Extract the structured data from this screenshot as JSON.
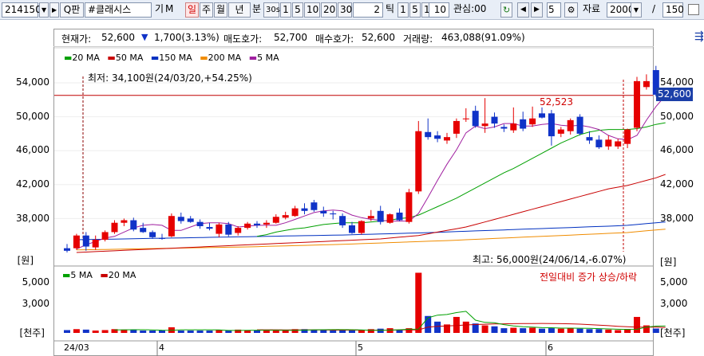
{
  "toolbar": {
    "code": "214150",
    "search_icon_label": "Q",
    "search_label": "판",
    "name": "#클래시스",
    "gi": "기",
    "m": "M",
    "periods": [
      "일",
      "주",
      "월",
      "년"
    ],
    "bun": "분",
    "sec": "30s",
    "min_opts": [
      "1",
      "5",
      "10",
      "20",
      "30"
    ],
    "tick_value": "2",
    "tick_label": "틱",
    "tick_opts": [
      "1",
      "5",
      "10"
    ],
    "tick_sel": "10",
    "interest": "관심:00",
    "nav_value": "5",
    "data_label": "자료",
    "data_count": "2000",
    "slash": "/",
    "view_count": "150"
  },
  "info": {
    "price_label": "현재가:",
    "price": "52,600",
    "change": "1,700(3.13%)",
    "ask_label": "매도호가:",
    "ask": "52,700",
    "bid_label": "매수호가:",
    "bid": "52,600",
    "vol_label": "거래량:",
    "vol": "463,088(91.09%)"
  },
  "legend": {
    "price": [
      "20 MA",
      "50 MA",
      "150 MA",
      "200 MA",
      "5 MA"
    ],
    "volume": [
      "5 MA",
      "20 MA"
    ]
  },
  "colors": {
    "up": "#e60000",
    "down": "#1033c8",
    "ma5": "#a020a0",
    "ma20": "#00a000",
    "ma50": "#c80000",
    "ma150": "#0030c0",
    "ma200": "#f08c00"
  },
  "labels": {
    "min": "최저: 34,100원(24/03/20,+54.25%)",
    "max": "최고: 56,000원(24/06/14,-6.07%)",
    "ref_value": "52,523",
    "current": "52,600",
    "unit_price": "[원]",
    "unit_volume": "[천주]",
    "vol_note": "전일대비 증가 상승/하락"
  },
  "axes": {
    "price_ticks": [
      "54,000",
      "50,000",
      "46,000",
      "42,000",
      "38,000"
    ],
    "volume_ticks": [
      "5,000",
      "3,000"
    ],
    "x_labels": [
      "24/03",
      "4",
      "5",
      "6"
    ]
  },
  "chart_data": {
    "type": "candlestick",
    "price_ticks": [
      54000,
      50000,
      46000,
      42000,
      38000
    ],
    "volume_ticks": [
      5000,
      3000
    ],
    "reference_line": 52523,
    "current_price": 52600,
    "candles": [
      {
        "o": 34500,
        "h": 35000,
        "l": 34000,
        "c": 34200,
        "v": 300
      },
      {
        "o": 34500,
        "h": 36200,
        "l": 34300,
        "c": 36000,
        "v": 400
      },
      {
        "o": 36000,
        "h": 36400,
        "l": 34200,
        "c": 34700,
        "v": 350
      },
      {
        "o": 34600,
        "h": 36000,
        "l": 34300,
        "c": 35500,
        "v": 250
      },
      {
        "o": 35500,
        "h": 36600,
        "l": 35300,
        "c": 36400,
        "v": 300
      },
      {
        "o": 36400,
        "h": 37800,
        "l": 36200,
        "c": 37500,
        "v": 400
      },
      {
        "o": 37500,
        "h": 38000,
        "l": 37100,
        "c": 37800,
        "v": 350
      },
      {
        "o": 37800,
        "h": 38100,
        "l": 36500,
        "c": 36700,
        "v": 300
      },
      {
        "o": 36900,
        "h": 37500,
        "l": 36300,
        "c": 36400,
        "v": 250
      },
      {
        "o": 36400,
        "h": 36600,
        "l": 35600,
        "c": 35800,
        "v": 250
      },
      {
        "o": 35700,
        "h": 36200,
        "l": 35500,
        "c": 35600,
        "v": 250
      },
      {
        "o": 35900,
        "h": 38600,
        "l": 35800,
        "c": 38300,
        "v": 600
      },
      {
        "o": 38200,
        "h": 38700,
        "l": 37400,
        "c": 37700,
        "v": 250
      },
      {
        "o": 38000,
        "h": 38300,
        "l": 37500,
        "c": 37600,
        "v": 250
      },
      {
        "o": 37600,
        "h": 37900,
        "l": 36800,
        "c": 37100,
        "v": 250
      },
      {
        "o": 37000,
        "h": 37500,
        "l": 36600,
        "c": 36800,
        "v": 250
      },
      {
        "o": 36200,
        "h": 37500,
        "l": 35800,
        "c": 37300,
        "v": 300
      },
      {
        "o": 37300,
        "h": 37600,
        "l": 35900,
        "c": 36100,
        "v": 250
      },
      {
        "o": 36300,
        "h": 37100,
        "l": 36000,
        "c": 36900,
        "v": 350
      },
      {
        "o": 36900,
        "h": 37600,
        "l": 36700,
        "c": 37400,
        "v": 300
      },
      {
        "o": 37400,
        "h": 37700,
        "l": 36900,
        "c": 37200,
        "v": 250
      },
      {
        "o": 37300,
        "h": 37800,
        "l": 36900,
        "c": 37500,
        "v": 250
      },
      {
        "o": 37500,
        "h": 38500,
        "l": 37400,
        "c": 38200,
        "v": 250
      },
      {
        "o": 38100,
        "h": 38800,
        "l": 37900,
        "c": 38400,
        "v": 300
      },
      {
        "o": 38300,
        "h": 39500,
        "l": 38200,
        "c": 39200,
        "v": 400
      },
      {
        "o": 39200,
        "h": 39800,
        "l": 38500,
        "c": 38900,
        "v": 400
      },
      {
        "o": 39900,
        "h": 40200,
        "l": 38800,
        "c": 39000,
        "v": 350
      },
      {
        "o": 38900,
        "h": 39400,
        "l": 38200,
        "c": 38600,
        "v": 300
      },
      {
        "o": 38600,
        "h": 38900,
        "l": 37900,
        "c": 38500,
        "v": 250
      },
      {
        "o": 38300,
        "h": 38600,
        "l": 36900,
        "c": 37200,
        "v": 300
      },
      {
        "o": 37200,
        "h": 37600,
        "l": 36200,
        "c": 36300,
        "v": 250
      },
      {
        "o": 36300,
        "h": 37800,
        "l": 36100,
        "c": 37700,
        "v": 300
      },
      {
        "o": 38000,
        "h": 39000,
        "l": 37700,
        "c": 38300,
        "v": 400
      },
      {
        "o": 38900,
        "h": 39500,
        "l": 37300,
        "c": 37600,
        "v": 450
      },
      {
        "o": 37500,
        "h": 38600,
        "l": 37400,
        "c": 38500,
        "v": 500
      },
      {
        "o": 38700,
        "h": 39200,
        "l": 37700,
        "c": 37800,
        "v": 300
      },
      {
        "o": 37600,
        "h": 41500,
        "l": 37400,
        "c": 41100,
        "v": 500
      },
      {
        "o": 41200,
        "h": 49500,
        "l": 40900,
        "c": 48300,
        "v": 6400
      },
      {
        "o": 48200,
        "h": 49800,
        "l": 47300,
        "c": 47600,
        "v": 1800
      },
      {
        "o": 47800,
        "h": 48300,
        "l": 47000,
        "c": 47400,
        "v": 1200
      },
      {
        "o": 47200,
        "h": 48100,
        "l": 46800,
        "c": 47600,
        "v": 900
      },
      {
        "o": 48000,
        "h": 49800,
        "l": 47500,
        "c": 49500,
        "v": 1700
      },
      {
        "o": 49700,
        "h": 51000,
        "l": 49400,
        "c": 49800,
        "v": 1200
      },
      {
        "o": 50700,
        "h": 51300,
        "l": 48700,
        "c": 48900,
        "v": 1000
      },
      {
        "o": 48900,
        "h": 52200,
        "l": 48100,
        "c": 49200,
        "v": 800
      },
      {
        "o": 50000,
        "h": 50500,
        "l": 48700,
        "c": 49200,
        "v": 700
      },
      {
        "o": 48800,
        "h": 49100,
        "l": 48200,
        "c": 48600,
        "v": 500
      },
      {
        "o": 48400,
        "h": 51100,
        "l": 48100,
        "c": 49200,
        "v": 550
      },
      {
        "o": 49700,
        "h": 50600,
        "l": 48300,
        "c": 48600,
        "v": 500
      },
      {
        "o": 49100,
        "h": 51200,
        "l": 48800,
        "c": 49800,
        "v": 550
      },
      {
        "o": 50400,
        "h": 51100,
        "l": 49800,
        "c": 49900,
        "v": 450
      },
      {
        "o": 50400,
        "h": 50800,
        "l": 46600,
        "c": 47700,
        "v": 500
      },
      {
        "o": 48000,
        "h": 48800,
        "l": 47600,
        "c": 48500,
        "v": 450
      },
      {
        "o": 48300,
        "h": 49800,
        "l": 47900,
        "c": 49600,
        "v": 500
      },
      {
        "o": 50000,
        "h": 50300,
        "l": 47800,
        "c": 48000,
        "v": 450
      },
      {
        "o": 47600,
        "h": 48300,
        "l": 46800,
        "c": 47200,
        "v": 400
      },
      {
        "o": 47300,
        "h": 47800,
        "l": 46200,
        "c": 46400,
        "v": 400
      },
      {
        "o": 46500,
        "h": 47800,
        "l": 46100,
        "c": 47300,
        "v": 350
      },
      {
        "o": 46500,
        "h": 47400,
        "l": 46200,
        "c": 47100,
        "v": 300
      },
      {
        "o": 46800,
        "h": 48600,
        "l": 46300,
        "c": 48500,
        "v": 400
      },
      {
        "o": 48700,
        "h": 54700,
        "l": 48300,
        "c": 54200,
        "v": 1700
      },
      {
        "o": 53500,
        "h": 55000,
        "l": 53200,
        "c": 54200,
        "v": 800
      },
      {
        "o": 55500,
        "h": 56000,
        "l": 52400,
        "c": 52600,
        "v": 463
      }
    ],
    "ma5": [
      34400,
      34900,
      35300,
      35700,
      35900,
      36400,
      36900,
      37200,
      37300,
      37200,
      36600,
      36600,
      37000,
      37400,
      37500,
      37500,
      37400,
      37000,
      37100,
      37200,
      37200,
      37200,
      37500,
      37900,
      38300,
      38700,
      38900,
      39000,
      38900,
      38400,
      38100,
      37900,
      37800,
      37700,
      37700,
      37700,
      38600,
      40500,
      42500,
      44400,
      46100,
      48100,
      48900,
      48600,
      48800,
      49200,
      49200,
      48900,
      48900,
      49100,
      49200,
      49000,
      48900,
      49000,
      48800,
      48500,
      47800,
      47400,
      47300,
      47800,
      49600,
      51200,
      52500
    ],
    "ma20": [
      null,
      null,
      null,
      null,
      null,
      null,
      null,
      null,
      null,
      null,
      null,
      null,
      null,
      null,
      null,
      null,
      null,
      null,
      null,
      35900,
      36100,
      36400,
      36600,
      36800,
      36900,
      37100,
      37300,
      37400,
      37500,
      37500,
      37500,
      37600,
      37700,
      37800,
      38000,
      38100,
      38400,
      38900,
      39400,
      39900,
      40400,
      41000,
      41600,
      42200,
      42800,
      43400,
      43900,
      44500,
      45100,
      45700,
      46300,
      46900,
      47400,
      47900,
      48200,
      48400,
      48500,
      48500,
      48500,
      48600,
      48800,
      49100,
      49300
    ],
    "ma50": [
      34000,
      34050,
      34100,
      34150,
      34200,
      34250,
      34300,
      34350,
      34400,
      34450,
      34500,
      34550,
      34600,
      34650,
      34700,
      34750,
      34800,
      34850,
      34900,
      34950,
      35000,
      35050,
      35100,
      35150,
      35200,
      35250,
      35300,
      35350,
      35400,
      35450,
      35500,
      35550,
      35600,
      35700,
      35800,
      35900,
      36000,
      36200,
      36400,
      36600,
      36800,
      37000,
      37300,
      37600,
      37900,
      38200,
      38500,
      38800,
      39100,
      39400,
      39700,
      40000,
      40300,
      40600,
      40900,
      41200,
      41500,
      41700,
      41900,
      42200,
      42500,
      42800,
      43200
    ],
    "ma150": [
      35500,
      35520,
      35540,
      35560,
      35580,
      35600,
      35620,
      35640,
      35660,
      35680,
      35700,
      35720,
      35740,
      35760,
      35780,
      35800,
      35820,
      35840,
      35860,
      35880,
      35900,
      35920,
      35940,
      35960,
      35980,
      36000,
      36020,
      36040,
      36060,
      36090,
      36120,
      36150,
      36180,
      36210,
      36240,
      36270,
      36300,
      36340,
      36380,
      36420,
      36460,
      36500,
      36540,
      36580,
      36620,
      36660,
      36700,
      36740,
      36780,
      36820,
      36860,
      36900,
      36940,
      36980,
      37020,
      37060,
      37100,
      37150,
      37200,
      37300,
      37400,
      37500,
      37600
    ],
    "ma200": [
      34300,
      34320,
      34340,
      34360,
      34380,
      34400,
      34420,
      34440,
      34460,
      34480,
      34500,
      34520,
      34540,
      34560,
      34580,
      34600,
      34620,
      34640,
      34660,
      34690,
      34720,
      34750,
      34780,
      34810,
      34840,
      34870,
      34900,
      34930,
      34960,
      35000,
      35040,
      35080,
      35120,
      35160,
      35200,
      35240,
      35280,
      35320,
      35360,
      35400,
      35450,
      35500,
      35550,
      35600,
      35650,
      35700,
      35750,
      35800,
      35850,
      35900,
      35950,
      36000,
      36050,
      36100,
      36150,
      36200,
      36250,
      36300,
      36350,
      36450,
      36550,
      36650,
      36750
    ],
    "vma5": [
      null,
      null,
      null,
      null,
      320,
      330,
      340,
      340,
      320,
      290,
      280,
      330,
      330,
      330,
      330,
      320,
      260,
      260,
      280,
      290,
      290,
      290,
      270,
      270,
      300,
      330,
      340,
      350,
      350,
      340,
      320,
      280,
      280,
      300,
      340,
      390,
      400,
      1610,
      1890,
      1960,
      2160,
      2300,
      1360,
      1120,
      1080,
      880,
      740,
      650,
      610,
      560,
      550,
      510,
      510,
      500,
      490,
      460,
      420,
      390,
      370,
      380,
      620,
      720,
      730
    ],
    "vma20": [
      null,
      null,
      null,
      null,
      null,
      null,
      null,
      null,
      null,
      null,
      null,
      null,
      null,
      null,
      null,
      null,
      null,
      null,
      null,
      330,
      330,
      330,
      320,
      320,
      310,
      310,
      310,
      300,
      300,
      300,
      300,
      300,
      300,
      300,
      310,
      310,
      320,
      620,
      700,
      740,
      780,
      850,
      890,
      920,
      950,
      970,
      980,
      990,
      1000,
      1010,
      1000,
      980,
      970,
      930,
      880,
      820,
      770,
      700,
      650,
      610,
      620,
      610,
      580
    ]
  }
}
